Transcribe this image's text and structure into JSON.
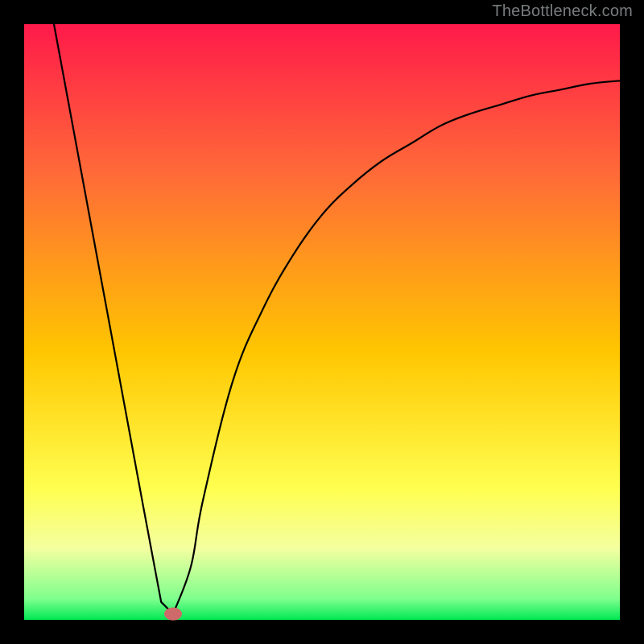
{
  "attribution": "TheBottleneck.com",
  "chart_data": {
    "type": "line",
    "title": "",
    "xlabel": "",
    "ylabel": "",
    "xlim": [
      0,
      100
    ],
    "ylim": [
      0,
      100
    ],
    "grid": false,
    "series": [
      {
        "name": "curve",
        "x": [
          5,
          10,
          15,
          20,
          23,
          25,
          28,
          30,
          35,
          40,
          45,
          50,
          55,
          60,
          65,
          70,
          75,
          80,
          85,
          90,
          95,
          100
        ],
        "y": [
          100,
          73,
          46,
          19,
          3,
          1,
          9,
          20,
          40,
          52,
          61,
          68,
          73,
          77,
          80,
          83,
          85,
          86.5,
          88,
          89,
          90,
          90.5
        ]
      }
    ],
    "minimum_marker": {
      "x": 25,
      "y": 1
    },
    "background": {
      "type": "vertical-gradient",
      "stops": [
        {
          "offset": 0.0,
          "color": "#ff1a4a"
        },
        {
          "offset": 0.25,
          "color": "#ff6a38"
        },
        {
          "offset": 0.55,
          "color": "#ffc600"
        },
        {
          "offset": 0.78,
          "color": "#ffff50"
        },
        {
          "offset": 0.88,
          "color": "#f4ffa0"
        },
        {
          "offset": 0.965,
          "color": "#7eff8d"
        },
        {
          "offset": 1.0,
          "color": "#00e853"
        }
      ]
    },
    "frame_color": "#000000",
    "curve_color": "#000000",
    "marker_color": "#cf6a6a"
  }
}
